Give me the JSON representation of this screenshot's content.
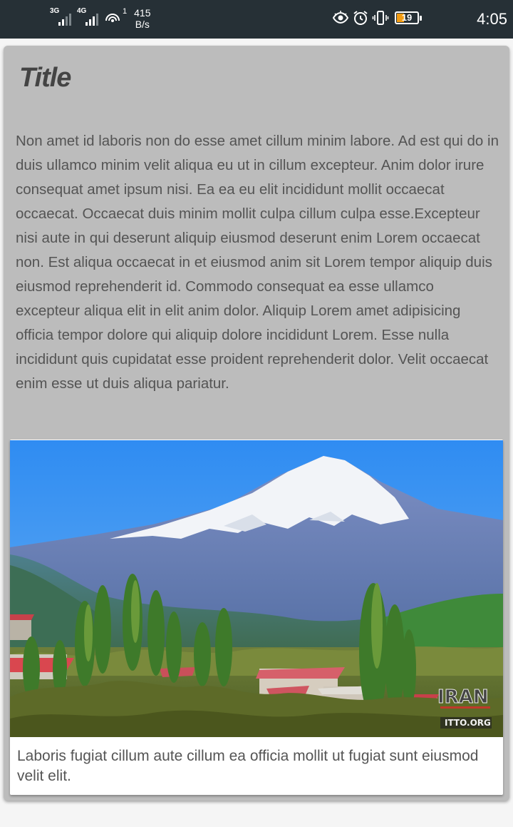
{
  "status_bar": {
    "network_1": "3G",
    "network_2": "4G",
    "hotspot_count": "1",
    "speed_value": "415",
    "speed_unit": "B/s",
    "battery_level": "19",
    "time": "4:05",
    "icons": [
      "signal-3g-icon",
      "signal-4g-icon",
      "hotspot-icon",
      "eye-icon",
      "alarm-icon",
      "vibrate-icon",
      "battery-icon"
    ]
  },
  "card": {
    "title": "Title",
    "body": "Non amet id laboris non do esse amet cillum minim labore. Ad est qui do in duis ullamco minim velit aliqua eu ut in cillum excepteur. Anim dolor irure consequat amet ipsum nisi. Ea ea eu elit incididunt mollit occaecat occaecat. Occaecat duis minim mollit culpa cillum culpa esse.Excepteur nisi aute in qui deserunt aliquip eiusmod deserunt enim Lorem occaecat non. Est aliqua occaecat in et eiusmod anim sit Lorem tempor aliquip duis eiusmod reprehenderit id. Commodo consequat ea esse ullamco excepteur aliqua elit in elit anim dolor. Aliquip Lorem amet adipisicing officia tempor dolore qui aliquip dolore incididunt Lorem. Esse nulla incididunt quis cupidatat esse proident reprehenderit dolor. Velit occaecat enim esse ut duis aliqua pariatur.",
    "media": {
      "watermark_logo": "IRAN",
      "watermark_url": "ITTO.ORG",
      "caption": "Laboris fugiat cillum aute cillum ea officia mollit ut fugiat sunt eiusmod velit elit."
    }
  },
  "colors": {
    "status_bar_bg": "#263036",
    "card_bg": "#bcbcbc",
    "battery_fill": "#f39c12"
  }
}
